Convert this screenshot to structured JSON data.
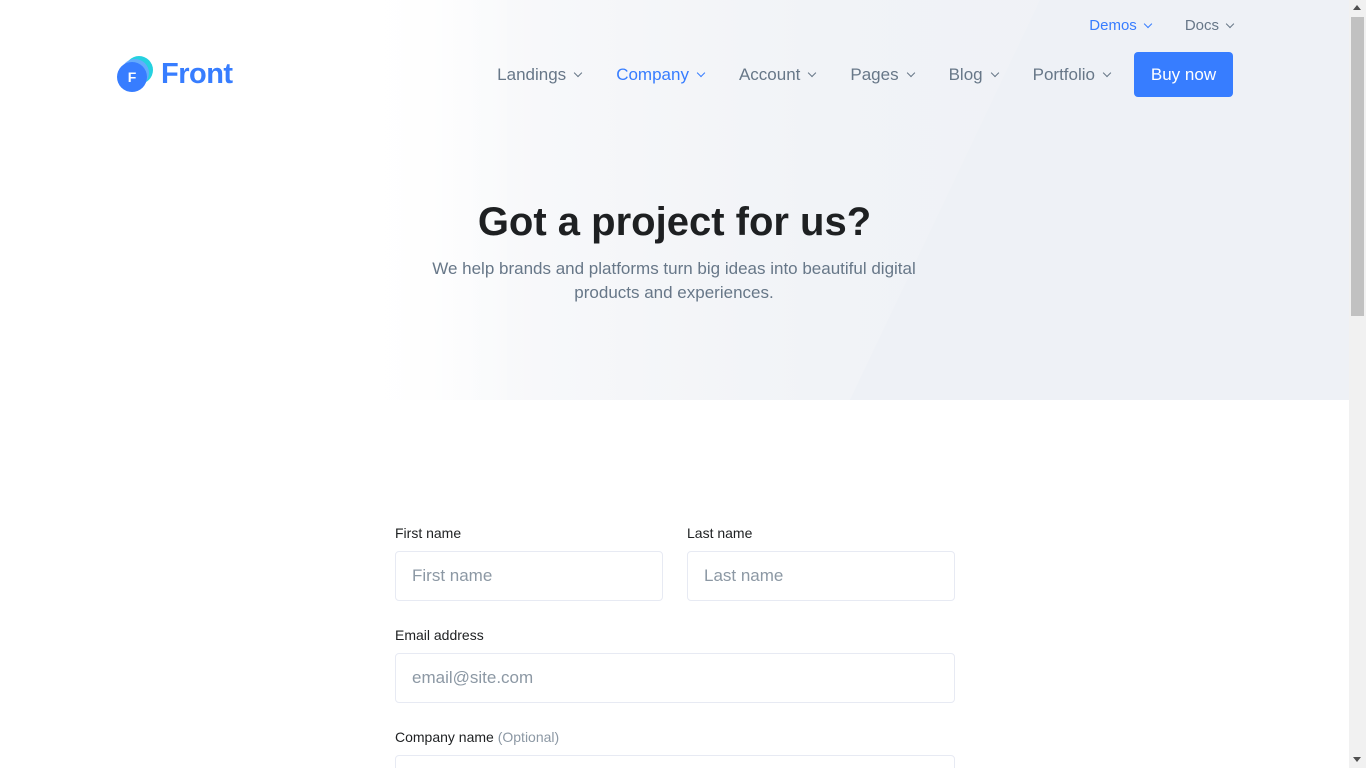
{
  "colors": {
    "primary": "#377dff",
    "text": "#1e2022",
    "muted": "#677788",
    "border": "#e7eaf3"
  },
  "topbar": {
    "items": [
      {
        "label": "Demos",
        "icon": "chevron-down-icon"
      },
      {
        "label": "Docs",
        "icon": "chevron-down-icon"
      }
    ]
  },
  "brand": {
    "mark_letter": "F",
    "name": "Front"
  },
  "nav": {
    "items": [
      {
        "label": "Landings"
      },
      {
        "label": "Company"
      },
      {
        "label": "Account"
      },
      {
        "label": "Pages"
      },
      {
        "label": "Blog"
      },
      {
        "label": "Portfolio"
      }
    ],
    "cta_label": "Buy now"
  },
  "hero": {
    "title": "Got a project for us?",
    "subtitle": "We help brands and platforms turn big ideas into beautiful digital products and experiences."
  },
  "form": {
    "first_name": {
      "label": "First name",
      "placeholder": "First name"
    },
    "last_name": {
      "label": "Last name",
      "placeholder": "Last name"
    },
    "email": {
      "label": "Email address",
      "placeholder": "email@site.com"
    },
    "company": {
      "label": "Company name",
      "optional": "(Optional)"
    }
  }
}
